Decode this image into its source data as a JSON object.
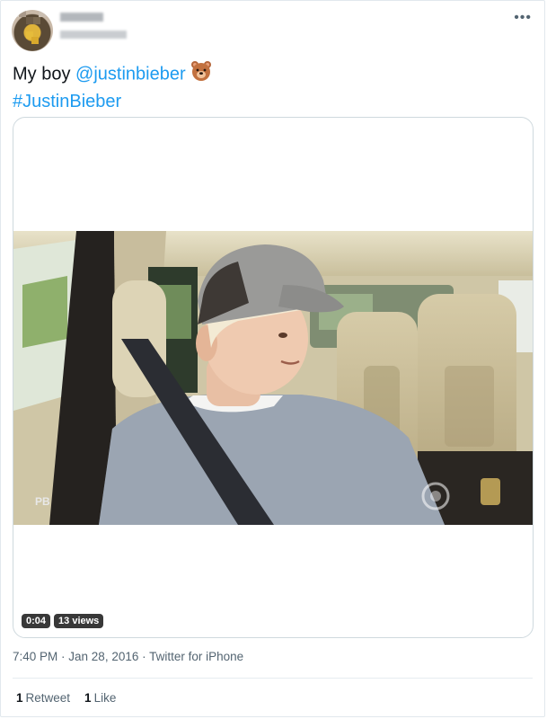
{
  "tweet": {
    "text_prefix": "My boy ",
    "mention": "@justinbieber",
    "emoji_icon": "bear-face-icon",
    "hashtag": "#JustinBieber",
    "more_icon": "more-horizontal-icon"
  },
  "video": {
    "duration": "0:04",
    "views": "13 views",
    "watermark": "PB"
  },
  "meta": {
    "time": "7:40 PM",
    "separator1": " · ",
    "date": "Jan 28, 2016",
    "separator2": " · ",
    "source": "Twitter for iPhone"
  },
  "stats": {
    "retweets_count": "1",
    "retweets_label": "Retweet",
    "likes_count": "1",
    "likes_label": "Like"
  },
  "colors": {
    "link": "#1d9bf0",
    "muted": "#536471",
    "border": "#cfd9de"
  }
}
